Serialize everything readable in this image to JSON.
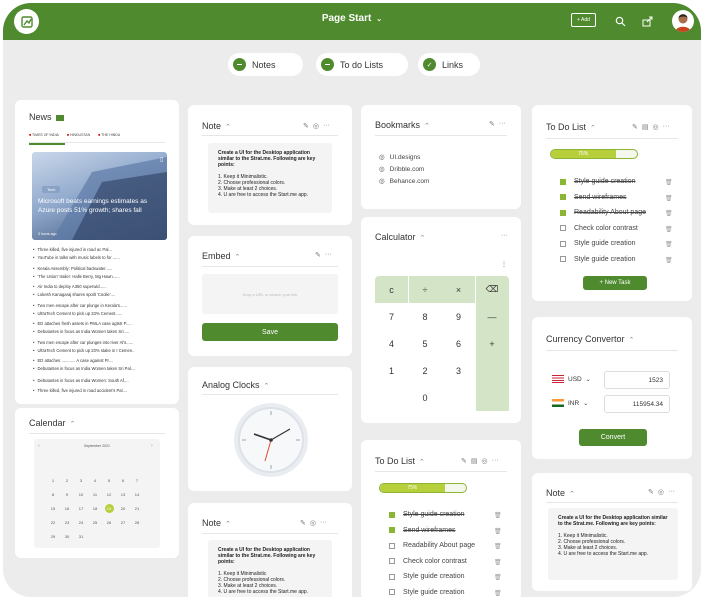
{
  "header": {
    "title": "Page Start",
    "add_label": "+ Add"
  },
  "tabs": [
    {
      "label": "Notes"
    },
    {
      "label": "To do Lists"
    },
    {
      "label": "Links"
    }
  ],
  "news": {
    "title": "News",
    "sources": [
      "TIMES OF INDIA",
      "HINDUSTAN",
      "THE HINDU"
    ],
    "badge": "Tech",
    "headline": "Microsoft beats earnings estimates as Azure posts 51% growth; shares fall",
    "date": "3 hours ago",
    "items": [
      "Three killed, five injured in road ac Pal...",
      "YouTube in talks with music labels to for ......",
      "Kerala Assembly: Political backwater......",
      "'The Union' trailer: Halle Berry, Mg Hawn......",
      "Air India to deploy A350 superwid......",
      "Lokesh Kanagaraj shares spoilt 'Coolie'....",
      "Two men escape after car plunge in Kerala's......",
      "UltraTech Cement to pick up 23% Cement......",
      "ED attaches fresh assets in PMLA case agtstr P.....",
      "Debutantes in focus as India Women taken Sri.....",
      "Two men escape after car plunges into river Al's......",
      "UltraTech Cement to pick up 23% stake in I Cemen..",
      "ED attaches ............ A case against Pr....",
      "Debutantes in focus as India Women taken Sri Pal....",
      "Debutantes in focus as India Women: South Af....",
      "Three killed, five injured in road accident's Pal...."
    ]
  },
  "calendar": {
    "title": "Calendar",
    "month": "September 2021",
    "rows": [
      [
        "",
        "",
        "",
        "",
        "",
        "",
        ""
      ],
      [
        "1",
        "2",
        "3",
        "4",
        "5",
        "6",
        "7"
      ],
      [
        "8",
        "9",
        "10",
        "11",
        "12",
        "13",
        "14"
      ],
      [
        "15",
        "16",
        "17",
        "18",
        "19",
        "20",
        "21"
      ],
      [
        "22",
        "23",
        "24",
        "25",
        "26",
        "27",
        "28"
      ],
      [
        "29",
        "30",
        "31",
        "",
        "",
        "",
        ""
      ]
    ],
    "selected": "19"
  },
  "note1": {
    "title": "Note",
    "heading": "Create a UI for the Desktop application similar to the Strat.me. Following are key points:",
    "points": [
      "1. Keep it Minimalistic.",
      "2. Choose professional colors.",
      "3. Make at least 2 choices.",
      "4. U are free to access the Start.me app."
    ]
  },
  "embed": {
    "title": "Embed",
    "placeholder": "Drop a URL or search your link",
    "button": "Save"
  },
  "clock": {
    "title": "Analog Clocks"
  },
  "note2": {
    "title": "Note",
    "heading": "Create a UI for the Desktop application similar to the Strat.me. Following are key points:",
    "points": [
      "1. Keep it Minimalistic",
      "2. Choose professional colors.",
      "3. Make at least 2 choices.",
      "4. U are free to access the Start.me app."
    ]
  },
  "bookmarks": {
    "title": "Bookmarks",
    "items": [
      "UI.designs",
      "Dribble.com",
      "Behance.com"
    ]
  },
  "calculator": {
    "title": "Calculator",
    "keys": [
      [
        "c",
        "÷",
        "×",
        "⌫"
      ],
      [
        "7",
        "8",
        "9",
        "—"
      ],
      [
        "4",
        "5",
        "6",
        "+"
      ],
      [
        "1",
        "2",
        "3",
        ""
      ],
      [
        "",
        "0",
        "",
        ""
      ]
    ]
  },
  "todo1": {
    "title": "To Do List",
    "progress_label": "75%",
    "progress": 0.75,
    "button": "+ New Task",
    "items": [
      {
        "text": "Style guide creation",
        "done": true
      },
      {
        "text": "Send wireframes",
        "done": true
      },
      {
        "text": "Readability About page",
        "done": true
      },
      {
        "text": "Check color contrast",
        "done": false
      },
      {
        "text": "Style guide creation",
        "done": false
      },
      {
        "text": "Style guide creation",
        "done": false
      }
    ]
  },
  "todo2": {
    "title": "To Do List",
    "progress_label": "75%",
    "progress": 0.75,
    "items": [
      {
        "text": "Style guide creation",
        "done": true
      },
      {
        "text": "Send wireframes",
        "done": true
      },
      {
        "text": "Readability About page",
        "done": false
      },
      {
        "text": "Check color contrast",
        "done": false
      },
      {
        "text": "Style guide creation",
        "done": false
      },
      {
        "text": "Style guide creation",
        "done": false
      }
    ]
  },
  "currency": {
    "title": "Currency Convertor",
    "from": "USD",
    "from_value": "1523",
    "to": "INR",
    "to_value": "115954.34",
    "button": "Convert"
  },
  "note3": {
    "title": "Note",
    "heading": "Create a UI for the Desktop application similar to the Strat.me. Following are key points:",
    "points": [
      "1. Keep it Minimalistic.",
      "2. Choose professional colors.",
      "3. Make at least 2 choices.",
      "4. U are free to access the Start.me app."
    ]
  },
  "colors": {
    "brand": "#4f8a2e",
    "progress": "#b6cf3b"
  }
}
